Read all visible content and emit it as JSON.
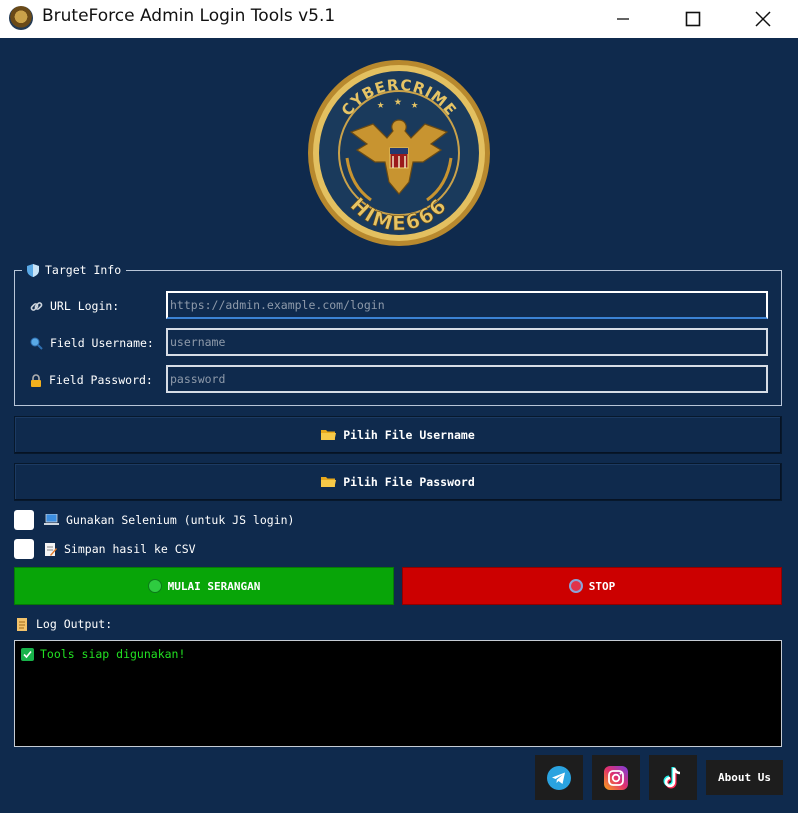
{
  "window": {
    "title": "BruteForce Admin Login Tools v5.1"
  },
  "target": {
    "legend": "Target Info",
    "url_label": "URL Login:",
    "url_placeholder": "https://admin.example.com/login",
    "url_value": "",
    "username_label": "Field Username:",
    "username_placeholder": "username",
    "username_value": "",
    "password_label": "Field Password:",
    "password_placeholder": "password",
    "password_value": ""
  },
  "files": {
    "username_button": "Pilih File Username",
    "password_button": "Pilih File Password"
  },
  "options": {
    "selenium_label": "Gunakan Selenium (untuk JS login)",
    "selenium_checked": false,
    "csv_label": "Simpan hasil ke CSV",
    "csv_checked": false
  },
  "actions": {
    "start_label": "MULAI SERANGAN",
    "stop_label": "STOP",
    "start_color": "#08a508",
    "stop_color": "#cc0000"
  },
  "log": {
    "label": "Log Output:",
    "lines": [
      "Tools siap digunakan!"
    ]
  },
  "footer": {
    "icons": [
      "telegram-icon",
      "instagram-icon",
      "tiktok-icon"
    ],
    "about_label": "About Us"
  },
  "emblem": {
    "top_text": "CYBERCRIME",
    "bottom_text": "HIME666"
  },
  "colors": {
    "background": "#0f2a4d",
    "log_text": "#22e022"
  }
}
